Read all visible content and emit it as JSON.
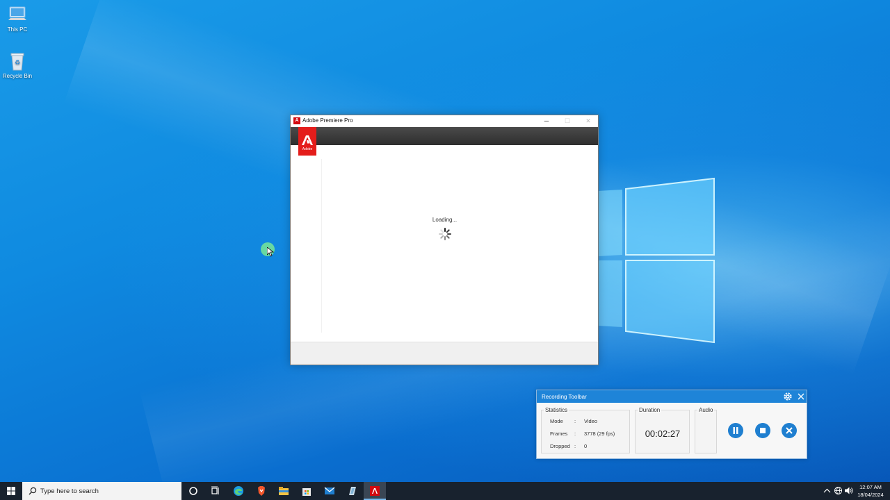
{
  "desktop": {
    "icons": [
      {
        "label": "This PC",
        "icon": "computer-icon"
      },
      {
        "label": "Recycle Bin",
        "icon": "recycle-bin-icon"
      }
    ]
  },
  "premiere_window": {
    "title": "Adobe Premiere Pro",
    "logo_text": "Adobe",
    "loading_text": "Loading...",
    "controls": {
      "minimize": "─",
      "maximize": "☐",
      "close": "✕"
    }
  },
  "recording_toolbar": {
    "title": "Recording Toolbar",
    "statistics": {
      "label": "Statistics",
      "rows": [
        {
          "key": "Mode",
          "sep": ":",
          "value": "Video"
        },
        {
          "key": "Frames",
          "sep": ":",
          "value": "3778 (29 fps)"
        },
        {
          "key": "Dropped",
          "sep": ":",
          "value": "0"
        }
      ]
    },
    "duration": {
      "label": "Duration",
      "value": "00:02:27"
    },
    "audio": {
      "label": "Audio"
    }
  },
  "taskbar": {
    "search_placeholder": "Type here to search",
    "apps": [
      "cortana-icon",
      "task-view-icon",
      "edge-icon",
      "brave-icon",
      "file-explorer-icon",
      "store-icon",
      "mail-icon",
      "app-icon",
      "premiere-icon"
    ],
    "clock": {
      "time": "12:07 AM",
      "date": "18/04/2024"
    }
  },
  "colors": {
    "accent": "#1e84d8",
    "adobe_red": "#e41d1b",
    "taskbar": "#18222e"
  }
}
